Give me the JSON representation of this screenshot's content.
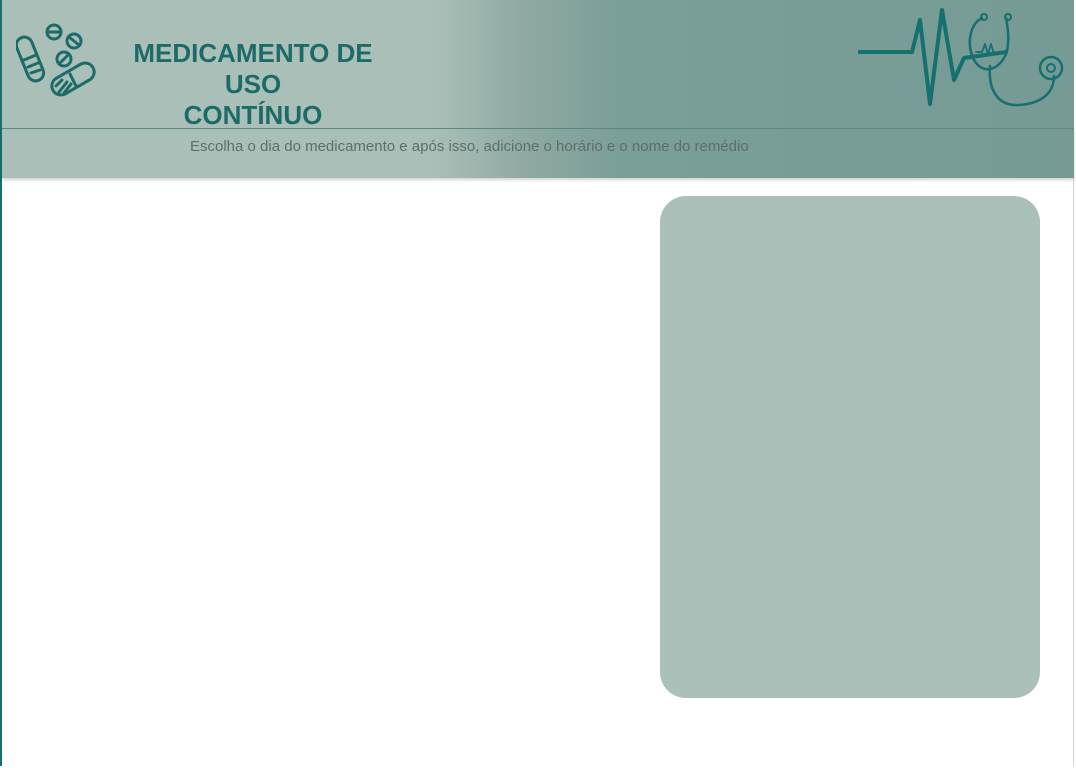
{
  "header": {
    "title_line1": "MEDICAMENTO DE USO",
    "title_line2": "CONTÍNUO",
    "logo_icon": "pills-icon",
    "decor_icon": "heartbeat-stethoscope-icon"
  },
  "subheader": {
    "instruction": "Escolha o dia do medicamento e após isso, adicione o horário e o nome do remédio"
  },
  "colors": {
    "accent": "#1d6b69",
    "header_light": "#aabfb8",
    "header_dark": "#769a94",
    "panel": "#aac0b9"
  }
}
